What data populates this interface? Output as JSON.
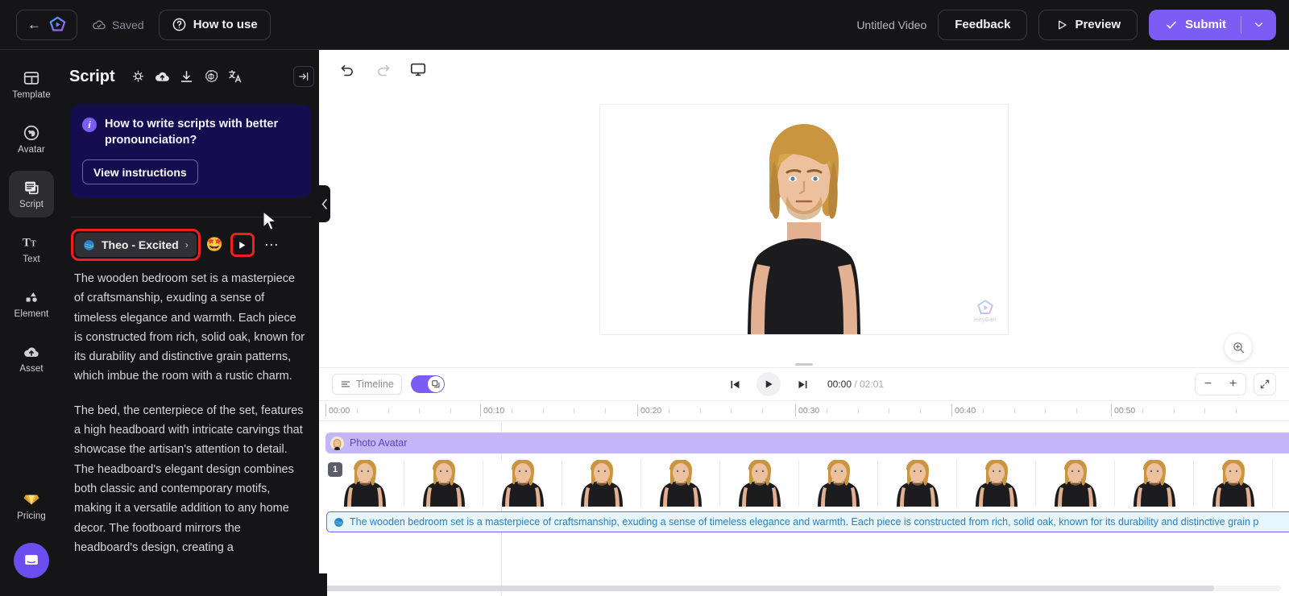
{
  "topbar": {
    "back_icon": "arrow-left-icon",
    "logo_icon": "brand-logo-icon",
    "saved_label": "Saved",
    "saved_icon": "cloud-check-icon",
    "how_to_label": "How to use",
    "how_to_icon": "question-circle-icon",
    "video_title": "Untitled Video",
    "feedback_label": "Feedback",
    "preview_label": "Preview",
    "preview_icon": "play-outline-icon",
    "submit_label": "Submit",
    "submit_icon": "check-icon",
    "submit_caret_icon": "chevron-down-icon",
    "submit_color": "#7b5cf5"
  },
  "rail": {
    "items": [
      {
        "label": "Template",
        "icon": "template-icon",
        "active": false
      },
      {
        "label": "Avatar",
        "icon": "avatar-icon",
        "active": false
      },
      {
        "label": "Script",
        "icon": "script-icon",
        "active": true
      },
      {
        "label": "Text",
        "icon": "text-icon",
        "active": false
      },
      {
        "label": "Element",
        "icon": "element-icon",
        "active": false
      },
      {
        "label": "Asset",
        "icon": "asset-upload-icon",
        "active": false
      }
    ],
    "pricing_label": "Pricing",
    "pricing_icon": "diamond-icon",
    "chat_icon": "intercom-chat-icon"
  },
  "script_panel": {
    "title": "Script",
    "header_icons": [
      "lightbulb-icon",
      "cloud-upload-icon",
      "download-icon",
      "openai-icon",
      "translate-icon"
    ],
    "collapse_icon": "panel-collapse-icon",
    "info": {
      "icon": "info-icon",
      "text": "How to write scripts with better pronounciation?",
      "button_label": "View instructions",
      "background": "#160d50"
    },
    "voice": {
      "avatar_icon": "voice-avatar-icon",
      "name": "Theo - Excited",
      "caret_icon": "chevron-right-icon",
      "emoji_icon": "star-struck-emoji",
      "play_icon": "play-icon",
      "more_icon": "more-horizontal-icon",
      "highlight_color": "#f01f1f"
    },
    "paragraphs": [
      "The wooden bedroom set is a masterpiece of craftsmanship, exuding a sense of timeless elegance and warmth. Each piece is constructed from rich, solid oak, known for its durability and distinctive grain patterns, which imbue the room with a rustic charm.",
      "The bed, the centerpiece of the set, features a high headboard with intricate carvings that showcase the artisan's attention to detail. The headboard's elegant design combines both classic and contemporary motifs, making it a versatile addition to any home decor. The footboard mirrors the headboard's design, creating a"
    ]
  },
  "stage": {
    "tools": [
      "undo-icon",
      "redo-icon",
      "screen-icon"
    ],
    "collapse_tab_icon": "chevron-left-icon",
    "watermark_text": "HeyGen",
    "zoom_fab_icon": "zoom-in-icon",
    "resize_grip_icon": "drag-handle-icon"
  },
  "timeline": {
    "timeline_button_label": "Timeline",
    "timeline_button_icon": "timeline-icon",
    "toggle_icon": "layers-icon",
    "toggle_on": true,
    "toggle_color": "#7b5cf5",
    "skip_start_icon": "skip-start-icon",
    "play_icon": "play-icon",
    "skip_end_icon": "skip-end-icon",
    "current_time": "00:00",
    "time_separator": " / ",
    "total_time": "02:01",
    "zoom_out_icon": "minus-icon",
    "zoom_in_icon": "plus-icon",
    "fit_icon": "fit-screen-icon",
    "playhead_color": "#f5a623",
    "ruler_labels": [
      "00:00",
      "00:10",
      "00:20",
      "00:30",
      "00:40",
      "00:50"
    ],
    "ruler_label_x": [
      413,
      605,
      800,
      996,
      1190,
      1388
    ],
    "tracks": {
      "avatar_clip_label": "Photo Avatar",
      "avatar_clip_color": "#c4b5f8",
      "avatar_clip_icon": "avatar-thumb-icon",
      "sequence_badge": "1",
      "script_clip_icon": "globe-icon",
      "script_clip_text": "The wooden bedroom set is a masterpiece of craftsmanship, exuding a sense of timeless elegance and warmth. Each piece is constructed from rich, solid oak, known for its durability and distinctive grain p",
      "script_clip_border": "#7b5cf5"
    }
  }
}
